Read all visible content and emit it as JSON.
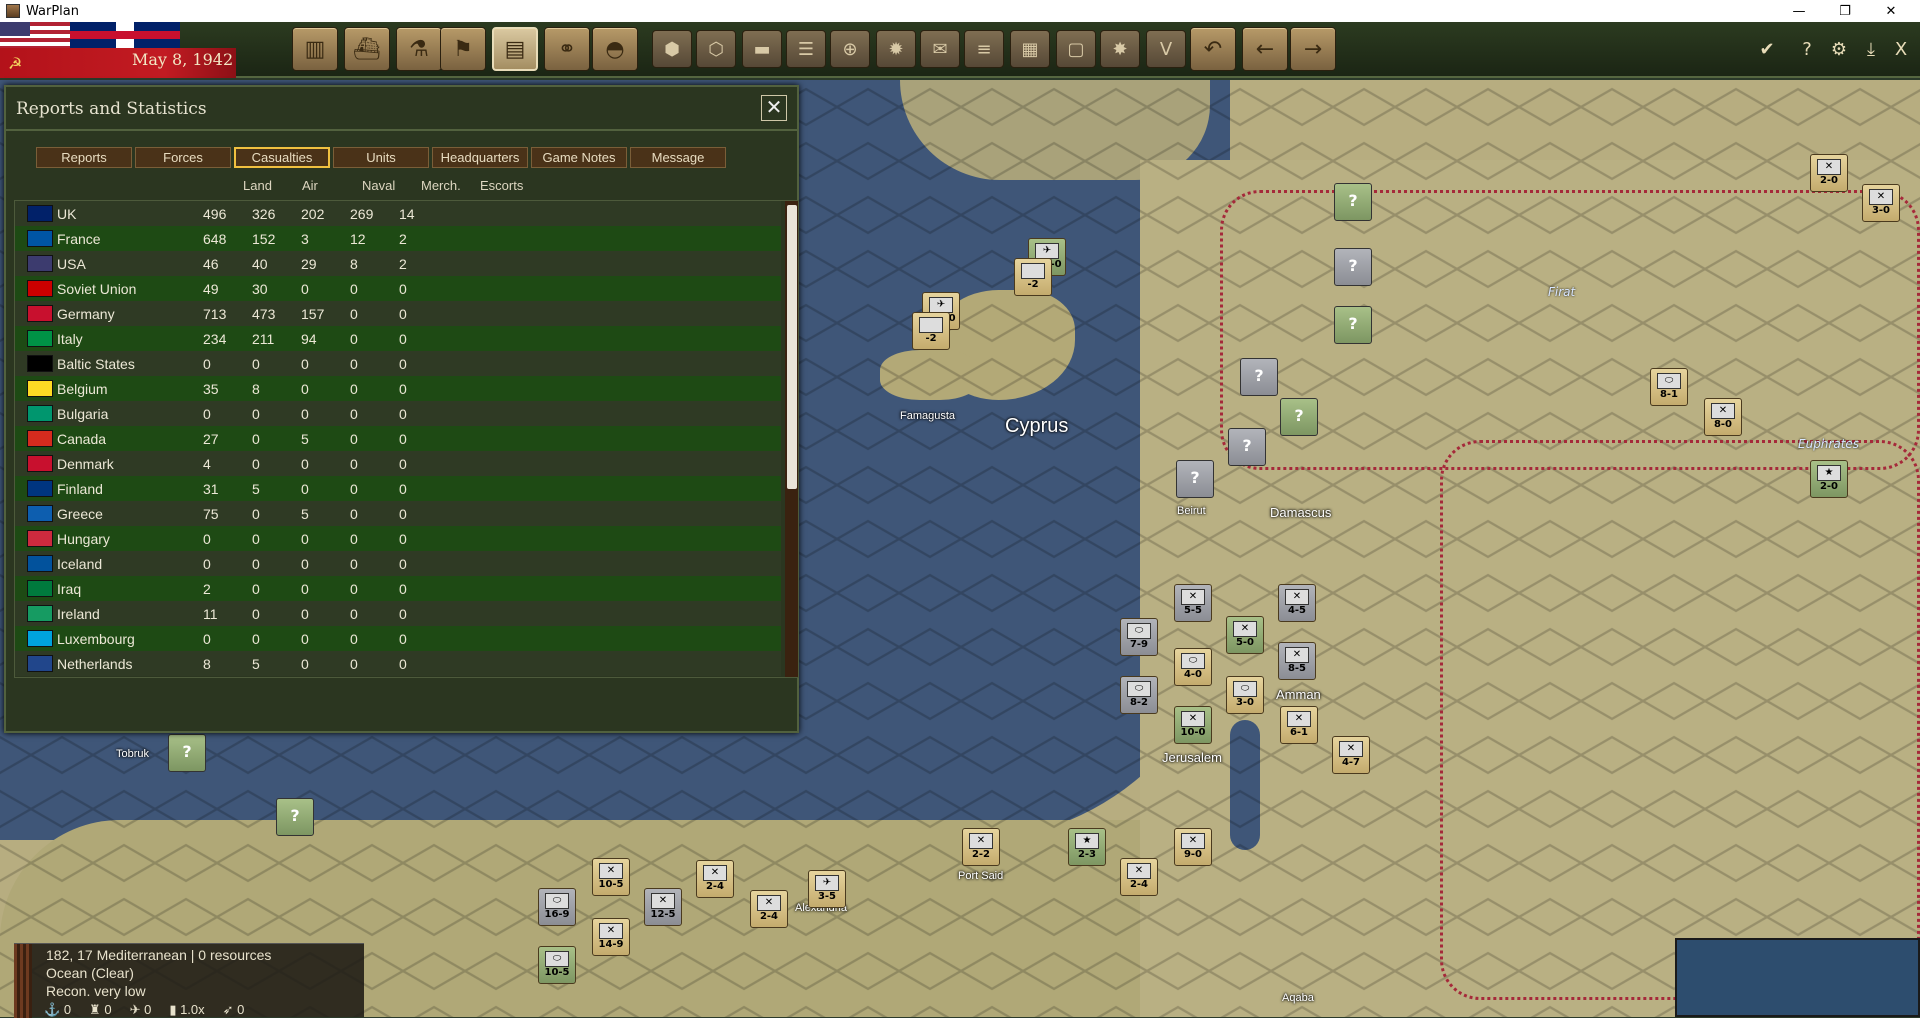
{
  "window": {
    "title": "WarPlan",
    "minimize": "—",
    "maximize": "❐",
    "close": "✕"
  },
  "topbar": {
    "date": "May 8, 1942",
    "toolbar_icons": [
      "factory-icon",
      "naval-icon",
      "research-icon",
      "flag-icon",
      "reports-icon",
      "binoculars-icon",
      "helmet-icon"
    ],
    "hex_icons": [
      "hex-icon",
      "hex-cluster-icon",
      "tank-icon",
      "supply-icon",
      "target-icon",
      "sun-icon",
      "mail-icon",
      "railway-icon",
      "grid-icon",
      "square-icon",
      "explosion-icon",
      "v-icon"
    ],
    "nav": {
      "undo": "↶",
      "back": "←",
      "forward": "→"
    },
    "right": {
      "done": "✔",
      "help": "?",
      "settings": "⚙",
      "download": "⤓",
      "exit": "X"
    }
  },
  "panel": {
    "title": "Reports and Statistics",
    "close": "✕",
    "tabs": [
      "Reports",
      "Forces",
      "Casualties",
      "Units",
      "Headquarters",
      "Game Notes",
      "Message"
    ],
    "active_tab": "Casualties",
    "columns": [
      "Land",
      "Air",
      "Naval",
      "Merch.",
      "Escorts"
    ],
    "rows": [
      {
        "country": "UK",
        "land": "496",
        "air": "326",
        "naval": "202",
        "merch": "269",
        "escorts": "14"
      },
      {
        "country": "France",
        "land": "648",
        "air": "152",
        "naval": "3",
        "merch": "12",
        "escorts": "2"
      },
      {
        "country": "USA",
        "land": "46",
        "air": "40",
        "naval": "29",
        "merch": "8",
        "escorts": "2"
      },
      {
        "country": "Soviet Union",
        "land": "49",
        "air": "30",
        "naval": "0",
        "merch": "0",
        "escorts": "0"
      },
      {
        "country": "Germany",
        "land": "713",
        "air": "473",
        "naval": "157",
        "merch": "0",
        "escorts": "0"
      },
      {
        "country": "Italy",
        "land": "234",
        "air": "211",
        "naval": "94",
        "merch": "0",
        "escorts": "0"
      },
      {
        "country": "Baltic States",
        "land": "0",
        "air": "0",
        "naval": "0",
        "merch": "0",
        "escorts": "0"
      },
      {
        "country": "Belgium",
        "land": "35",
        "air": "8",
        "naval": "0",
        "merch": "0",
        "escorts": "0"
      },
      {
        "country": "Bulgaria",
        "land": "0",
        "air": "0",
        "naval": "0",
        "merch": "0",
        "escorts": "0"
      },
      {
        "country": "Canada",
        "land": "27",
        "air": "0",
        "naval": "5",
        "merch": "0",
        "escorts": "0"
      },
      {
        "country": "Denmark",
        "land": "4",
        "air": "0",
        "naval": "0",
        "merch": "0",
        "escorts": "0"
      },
      {
        "country": "Finland",
        "land": "31",
        "air": "5",
        "naval": "0",
        "merch": "0",
        "escorts": "0"
      },
      {
        "country": "Greece",
        "land": "75",
        "air": "0",
        "naval": "5",
        "merch": "0",
        "escorts": "0"
      },
      {
        "country": "Hungary",
        "land": "0",
        "air": "0",
        "naval": "0",
        "merch": "0",
        "escorts": "0"
      },
      {
        "country": "Iceland",
        "land": "0",
        "air": "0",
        "naval": "0",
        "merch": "0",
        "escorts": "0"
      },
      {
        "country": "Iraq",
        "land": "2",
        "air": "0",
        "naval": "0",
        "merch": "0",
        "escorts": "0"
      },
      {
        "country": "Ireland",
        "land": "11",
        "air": "0",
        "naval": "0",
        "merch": "0",
        "escorts": "0"
      },
      {
        "country": "Luxembourg",
        "land": "0",
        "air": "0",
        "naval": "0",
        "merch": "0",
        "escorts": "0"
      },
      {
        "country": "Netherlands",
        "land": "8",
        "air": "5",
        "naval": "0",
        "merch": "0",
        "escorts": "0"
      }
    ],
    "flag_colors": [
      "#012169",
      "#0055a4",
      "#3c3b6e",
      "#cc0000",
      "#c8102e",
      "#009246",
      "#000000",
      "#fdda24",
      "#00966e",
      "#d52b1e",
      "#c8102e",
      "#003580",
      "#0d5eaf",
      "#cd2a3e",
      "#02529c",
      "#007a3d",
      "#169b62",
      "#00a3dd",
      "#21468b"
    ]
  },
  "map": {
    "labels": {
      "cyprus": "Cyprus",
      "famagusta": "Famagusta",
      "beirut": "Beirut",
      "damascus": "Damascus",
      "amman": "Amman",
      "jerusalem": "Jerusalem",
      "port_said": "Port Said",
      "alexandria": "Alexandria",
      "aqaba": "Aqaba",
      "tobruk": "Tobruk",
      "firat": "Firat",
      "euphrates": "Euphrates"
    },
    "units": [
      {
        "str": "1-0-0"
      },
      {
        "str": "-2"
      },
      {
        "str": "0-0-0"
      },
      {
        "str": "-2"
      },
      {
        "str": "2-0"
      },
      {
        "str": "3-0"
      },
      {
        "str": "8-1"
      },
      {
        "str": "8-0"
      },
      {
        "str": "2-0"
      },
      {
        "str": "5-5"
      },
      {
        "str": "4-5"
      },
      {
        "str": "7-9"
      },
      {
        "str": "5-0"
      },
      {
        "str": "4-0"
      },
      {
        "str": "8-5"
      },
      {
        "str": "8-2"
      },
      {
        "str": "3-0"
      },
      {
        "str": "10-0"
      },
      {
        "str": "6-1"
      },
      {
        "str": "4-7"
      },
      {
        "str": "10-5"
      },
      {
        "str": "16-9"
      },
      {
        "str": "12-5"
      },
      {
        "str": "2-4"
      },
      {
        "str": "2-4"
      },
      {
        "str": "3-5"
      },
      {
        "str": "2-2"
      },
      {
        "str": "2-3"
      },
      {
        "str": "2-4"
      },
      {
        "str": "9-0"
      },
      {
        "str": "14-9"
      },
      {
        "str": "10-5"
      }
    ],
    "question_mark": "?"
  },
  "info": {
    "line1": "182, 17 Mediterranean  |  0 resources",
    "line2": "Ocean (Clear)",
    "line3": "Recon. very low",
    "stats": [
      "0",
      "0",
      "0",
      "1.0x",
      "0"
    ]
  }
}
